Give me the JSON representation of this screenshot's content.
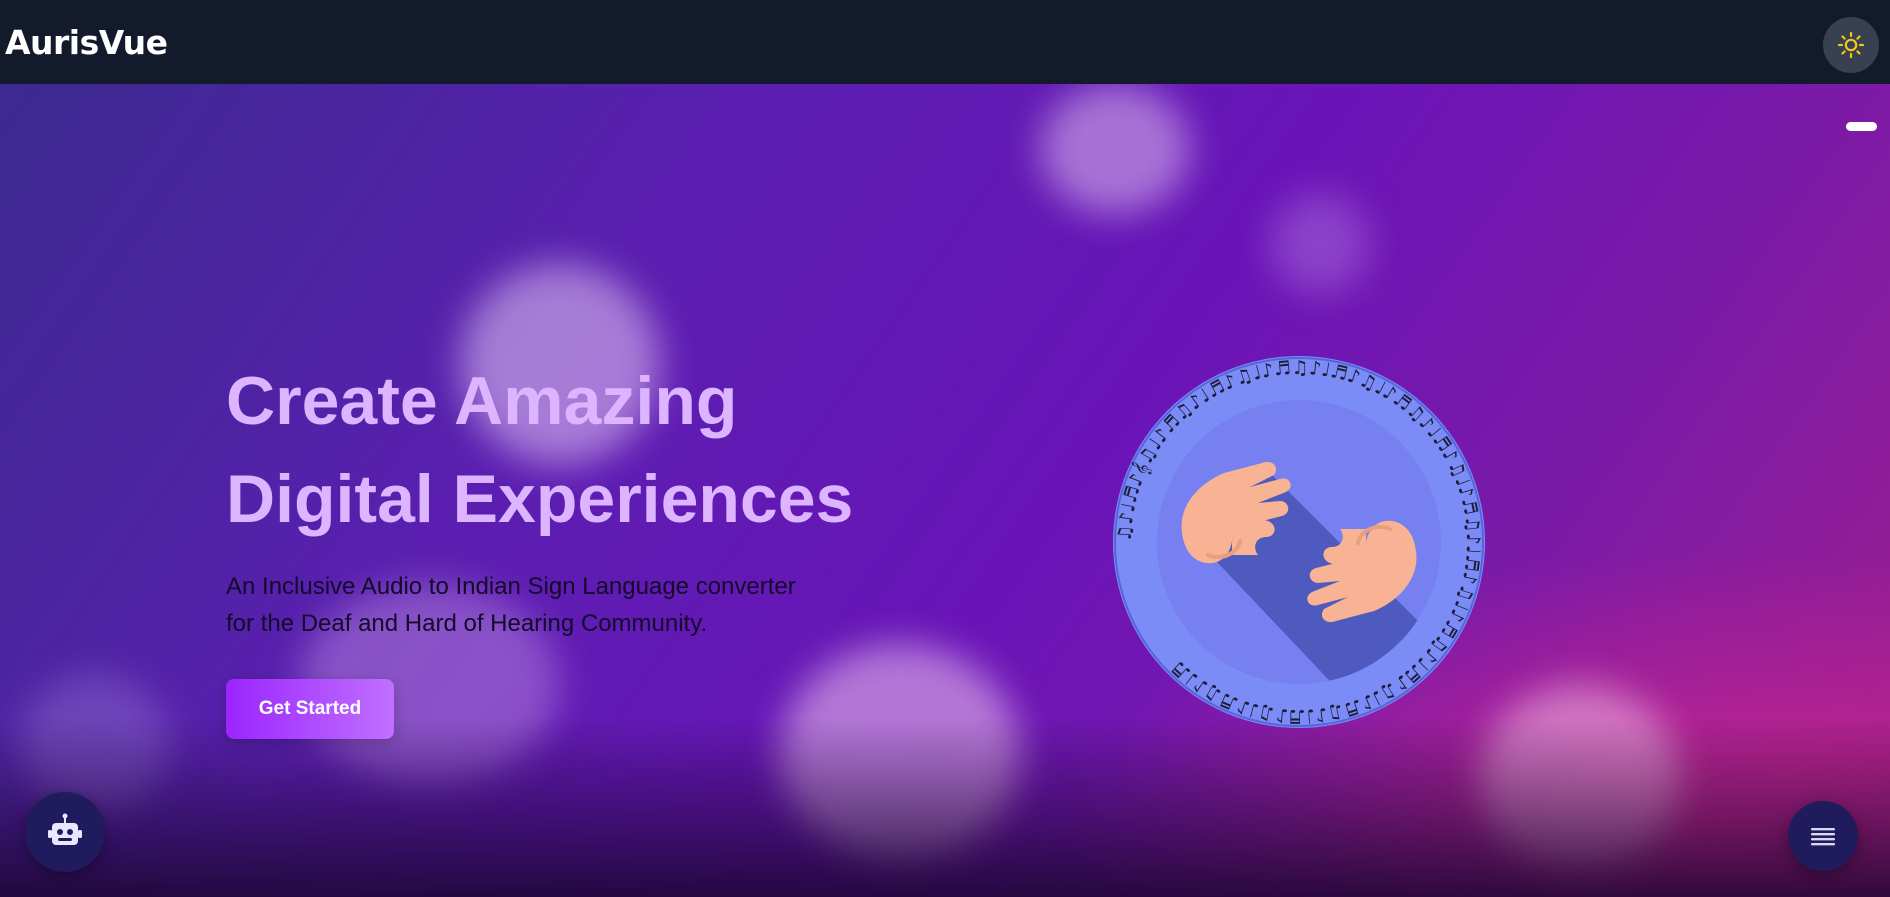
{
  "nav": {
    "brand": "AurisVue",
    "theme_toggle_icon": "sun-icon"
  },
  "hero": {
    "title_line1": "Create Amazing",
    "title_line2": "Digital Experiences",
    "subtitle_line1": "An Inclusive Audio to Indian Sign Language converter",
    "subtitle_line2": "for the Deaf and Hard of Hearing Community.",
    "cta_label": "Get Started",
    "logo_icon": "sign-language-hands-logo-icon"
  },
  "floating": {
    "chatbot_icon": "robot-icon",
    "menu_icon": "menu-icon"
  },
  "colors": {
    "navbar_bg": "#121a2b",
    "title": "#dcb4ff",
    "cta": "#9b25ff",
    "logo_ring": "#7b8cf6",
    "logo_inner": "#7780f0"
  }
}
